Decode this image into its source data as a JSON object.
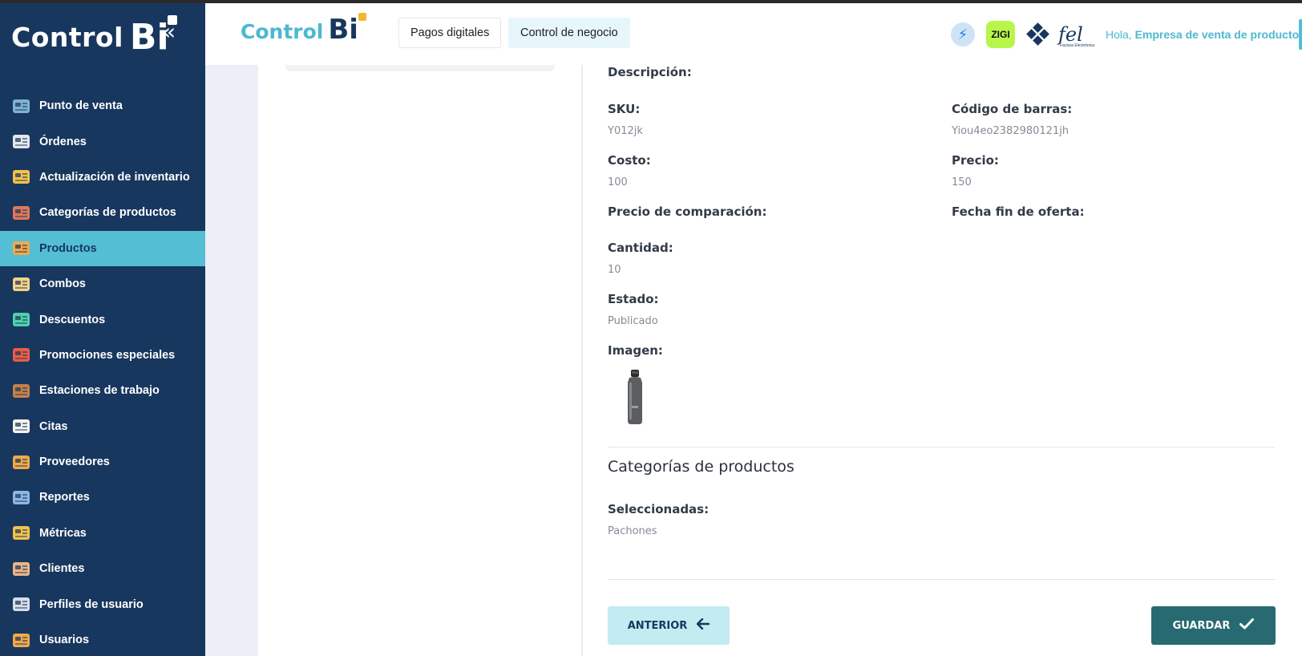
{
  "sidebar": {
    "brand_control": "Control",
    "brand_bi": "Bi",
    "collapse_icon": "«",
    "items": [
      {
        "label": "Punto de venta",
        "icon": "cash-register-icon",
        "color": "#7fb3d5"
      },
      {
        "label": "Órdenes",
        "icon": "orders-icon",
        "color": "#e2e7ee"
      },
      {
        "label": "Actualización de inventario",
        "icon": "inventory-icon",
        "color": "#f2c14e"
      },
      {
        "label": "Categorías de productos",
        "icon": "categories-icon",
        "color": "#e0785b"
      },
      {
        "label": "Productos",
        "icon": "products-icon",
        "color": "#f0a94c",
        "active": true
      },
      {
        "label": "Combos",
        "icon": "combos-icon",
        "color": "#f4d28a"
      },
      {
        "label": "Descuentos",
        "icon": "discount-icon",
        "color": "#4dd0b1"
      },
      {
        "label": "Promociones especiales",
        "icon": "promo-tag-icon",
        "color": "#e85c4a"
      },
      {
        "label": "Estaciones de trabajo",
        "icon": "workstation-icon",
        "color": "#c6804b"
      },
      {
        "label": "Citas",
        "icon": "calendar-icon",
        "color": "#f4f4f4"
      },
      {
        "label": "Proveedores",
        "icon": "suppliers-icon",
        "color": "#f0a94c"
      },
      {
        "label": "Reportes",
        "icon": "reports-icon",
        "color": "#8ab6e6"
      },
      {
        "label": "Métricas",
        "icon": "metrics-icon",
        "color": "#f2c14e"
      },
      {
        "label": "Clientes",
        "icon": "clients-icon",
        "color": "#e9b48a"
      },
      {
        "label": "Perfiles de usuario",
        "icon": "user-profile-icon",
        "color": "#d5dde8"
      },
      {
        "label": "Usuarios",
        "icon": "users-icon",
        "color": "#f0a94c"
      }
    ]
  },
  "header": {
    "logo_control": "Control",
    "logo_bi": "Bi",
    "tabs": [
      "Pagos digitales",
      "Control de negocio"
    ],
    "zigi": "ZIGI",
    "fel": "fel",
    "fel_sub": "Factura Electrónica",
    "greeting": "Hola,",
    "company": "Empresa de venta de productos"
  },
  "product": {
    "description_label": "Descripción:",
    "sku_label": "SKU:",
    "sku_value": "Y012jk",
    "barcode_label": "Código de barras:",
    "barcode_value": "Yiou4eo2382980121jh",
    "cost_label": "Costo:",
    "cost_value": "100",
    "price_label": "Precio:",
    "price_value": "150",
    "compare_price_label": "Precio de comparación:",
    "offer_end_label": "Fecha fin de oferta:",
    "quantity_label": "Cantidad:",
    "quantity_value": "10",
    "status_label": "Estado:",
    "status_value": "Publicado",
    "image_label": "Imagen:"
  },
  "categories": {
    "title": "Categorías de productos",
    "selected_label": "Seleccionadas:",
    "selected_value": "Pachones"
  },
  "actions": {
    "prev_label": "ANTERIOR",
    "save_label": "GUARDAR"
  },
  "colors": {
    "sidebar_bg": "#17375e",
    "active_bg": "#54bfd4",
    "save_bg": "#276a72",
    "prev_bg": "#c2ebf2",
    "accent": "#4db8d1"
  }
}
